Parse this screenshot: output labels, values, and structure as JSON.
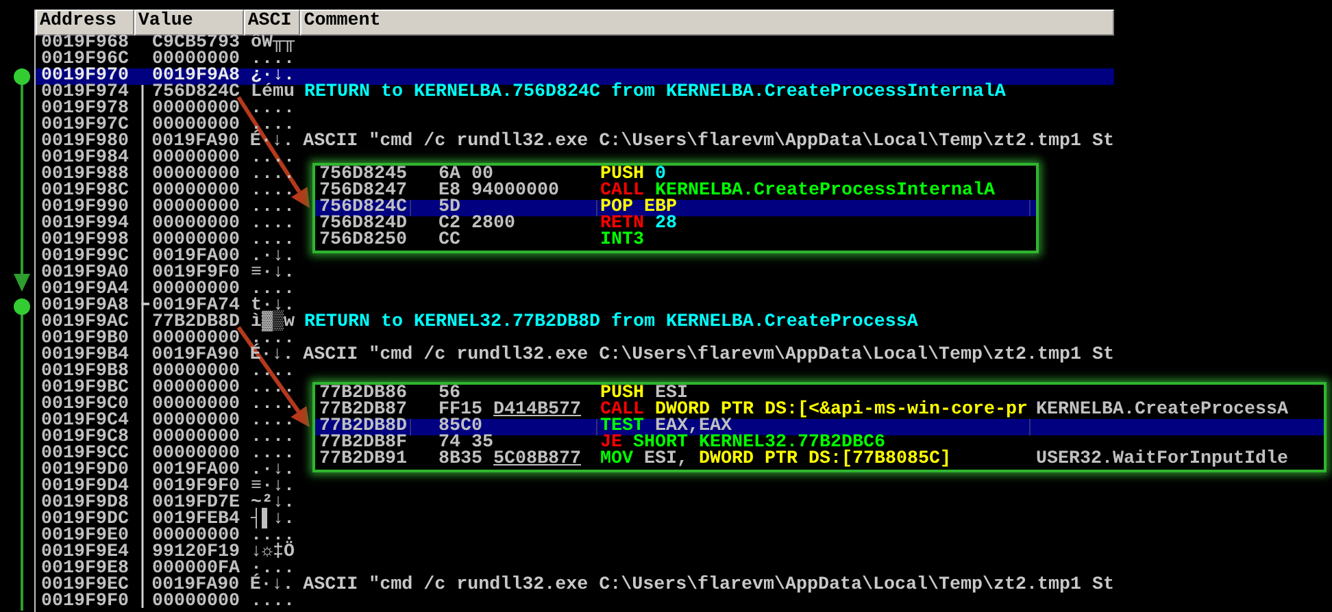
{
  "columns": [
    {
      "label": "Address"
    },
    {
      "label": "Value"
    },
    {
      "label": "ASCI"
    },
    {
      "label": "Comment"
    }
  ],
  "rows": [
    {
      "address": "0019F968",
      "value": "C9CB5793",
      "ascii": "ôW╥╥",
      "selected": false,
      "frame_start": false
    },
    {
      "address": "0019F96C",
      "value": "00000000",
      "ascii": "....",
      "selected": false,
      "frame_start": false
    },
    {
      "address": "0019F970",
      "value": "0019F9A8",
      "ascii": "¿·↓.",
      "selected": true,
      "frame_start": true
    },
    {
      "address": "0019F974",
      "value": "756D824C",
      "ascii": "Lému",
      "selected": false,
      "frame_start": false,
      "comment": {
        "kind": "return",
        "text": "RETURN to KERNELBA.756D824C from KERNELBA.CreateProcessInternalA"
      }
    },
    {
      "address": "0019F978",
      "value": "00000000",
      "ascii": "....",
      "selected": false,
      "frame_start": false
    },
    {
      "address": "0019F97C",
      "value": "00000000",
      "ascii": "....",
      "selected": false,
      "frame_start": false
    },
    {
      "address": "0019F980",
      "value": "0019FA90",
      "ascii": "É·↓.",
      "selected": false,
      "frame_start": false,
      "comment": {
        "kind": "ascii",
        "text": "ASCII \"cmd /c rundll32.exe C:\\Users\\flarevm\\AppData\\Local\\Temp\\zt2.tmp1 St"
      }
    },
    {
      "address": "0019F984",
      "value": "00000000",
      "ascii": "....",
      "selected": false,
      "frame_start": false
    },
    {
      "address": "0019F988",
      "value": "00000000",
      "ascii": "....",
      "selected": false,
      "frame_start": false
    },
    {
      "address": "0019F98C",
      "value": "00000000",
      "ascii": "....",
      "selected": false,
      "frame_start": false
    },
    {
      "address": "0019F990",
      "value": "00000000",
      "ascii": "....",
      "selected": false,
      "frame_start": false
    },
    {
      "address": "0019F994",
      "value": "00000000",
      "ascii": "....",
      "selected": false,
      "frame_start": false
    },
    {
      "address": "0019F998",
      "value": "00000000",
      "ascii": "....",
      "selected": false,
      "frame_start": false
    },
    {
      "address": "0019F99C",
      "value": "0019FA00",
      "ascii": ".·↓.",
      "selected": false,
      "frame_start": false
    },
    {
      "address": "0019F9A0",
      "value": "0019F9F0",
      "ascii": "≡·↓.",
      "selected": false,
      "frame_start": false
    },
    {
      "address": "0019F9A4",
      "value": "00000000",
      "ascii": "....",
      "selected": false,
      "frame_start": false
    },
    {
      "address": "0019F9A8",
      "value": "0019FA74",
      "ascii": "t·↓.",
      "selected": false,
      "frame_start": true
    },
    {
      "address": "0019F9AC",
      "value": "77B2DB8D",
      "ascii": "ì▓▒w",
      "selected": false,
      "frame_start": false,
      "comment": {
        "kind": "return",
        "text": "RETURN to KERNEL32.77B2DB8D from KERNELBA.CreateProcessA"
      }
    },
    {
      "address": "0019F9B0",
      "value": "00000000",
      "ascii": "....",
      "selected": false,
      "frame_start": false
    },
    {
      "address": "0019F9B4",
      "value": "0019FA90",
      "ascii": "É·↓.",
      "selected": false,
      "frame_start": false,
      "comment": {
        "kind": "ascii",
        "text": "ASCII \"cmd /c rundll32.exe C:\\Users\\flarevm\\AppData\\Local\\Temp\\zt2.tmp1 St"
      }
    },
    {
      "address": "0019F9B8",
      "value": "00000000",
      "ascii": "....",
      "selected": false,
      "frame_start": false
    },
    {
      "address": "0019F9BC",
      "value": "00000000",
      "ascii": "....",
      "selected": false,
      "frame_start": false
    },
    {
      "address": "0019F9C0",
      "value": "00000000",
      "ascii": "....",
      "selected": false,
      "frame_start": false
    },
    {
      "address": "0019F9C4",
      "value": "00000000",
      "ascii": "....",
      "selected": false,
      "frame_start": false
    },
    {
      "address": "0019F9C8",
      "value": "00000000",
      "ascii": "....",
      "selected": false,
      "frame_start": false
    },
    {
      "address": "0019F9CC",
      "value": "00000000",
      "ascii": "....",
      "selected": false,
      "frame_start": false
    },
    {
      "address": "0019F9D0",
      "value": "0019FA00",
      "ascii": ".·↓.",
      "selected": false,
      "frame_start": false
    },
    {
      "address": "0019F9D4",
      "value": "0019F9F0",
      "ascii": "≡·↓.",
      "selected": false,
      "frame_start": false
    },
    {
      "address": "0019F9D8",
      "value": "0019FD7E",
      "ascii": "~²↓.",
      "selected": false,
      "frame_start": false
    },
    {
      "address": "0019F9DC",
      "value": "0019FEB4",
      "ascii": "┤▌↓.",
      "selected": false,
      "frame_start": false
    },
    {
      "address": "0019F9E0",
      "value": "00000000",
      "ascii": "....",
      "selected": false,
      "frame_start": false
    },
    {
      "address": "0019F9E4",
      "value": "99120F19",
      "ascii": "↓☼‡Ö",
      "selected": false,
      "frame_start": false
    },
    {
      "address": "0019F9E8",
      "value": "000000FA",
      "ascii": "·...",
      "selected": false,
      "frame_start": false
    },
    {
      "address": "0019F9EC",
      "value": "0019FA90",
      "ascii": "É·↓.",
      "selected": false,
      "frame_start": false,
      "comment": {
        "kind": "ascii",
        "text": "ASCII \"cmd /c rundll32.exe C:\\Users\\flarevm\\AppData\\Local\\Temp\\zt2.tmp1 St"
      }
    },
    {
      "address": "0019F9F0",
      "value": "00000000",
      "ascii": "....",
      "selected": false,
      "frame_start": false
    }
  ],
  "popups": [
    {
      "rows": [
        {
          "address": "756D8245",
          "hex": "6A 00",
          "selected": false,
          "instruction": [
            {
              "text": "PUSH",
              "kind": "stack_op"
            },
            {
              "text": "0",
              "kind": "constant"
            }
          ]
        },
        {
          "address": "756D8247",
          "hex": "E8 94000000",
          "selected": false,
          "instruction": [
            {
              "text": "CALL",
              "kind": "branch_op"
            },
            {
              "text": "KERNELBA.CreateProcessInternalA",
              "kind": "label"
            }
          ]
        },
        {
          "address": "756D824C",
          "hex": "5D",
          "selected": true,
          "instruction": [
            {
              "text": "POP",
              "kind": "stack_op"
            },
            {
              "text": "EBP",
              "kind": "stack_operand"
            }
          ]
        },
        {
          "address": "756D824D",
          "hex": "C2 2800",
          "selected": false,
          "instruction": [
            {
              "text": "RETN",
              "kind": "branch_op"
            },
            {
              "text": "28",
              "kind": "constant"
            }
          ]
        },
        {
          "address": "756D8250",
          "hex": "CC",
          "selected": false,
          "instruction": [
            {
              "text": "INT3",
              "kind": "plain_op"
            }
          ]
        }
      ]
    },
    {
      "rows": [
        {
          "address": "77B2DB86",
          "hex": "56",
          "selected": false,
          "instruction": [
            {
              "text": "PUSH",
              "kind": "stack_op"
            },
            {
              "text": "ESI",
              "kind": "register"
            }
          ]
        },
        {
          "address": "77B2DB87",
          "hex": "FF15",
          "hex_ref": "D414B577",
          "selected": false,
          "instruction": [
            {
              "text": "CALL",
              "kind": "branch_op"
            },
            {
              "text": "DWORD PTR DS:[<&api-ms-win-core-pr",
              "kind": "memory"
            }
          ],
          "comment": "KERNELBA.CreateProcessA"
        },
        {
          "address": "77B2DB8D",
          "hex": "85C0",
          "selected": true,
          "instruction": [
            {
              "text": "TEST",
              "kind": "plain_op"
            },
            {
              "text": "EAX,EAX",
              "kind": "register"
            }
          ]
        },
        {
          "address": "77B2DB8F",
          "hex": "74 35",
          "selected": false,
          "instruction": [
            {
              "text": "JE",
              "kind": "branch_op"
            },
            {
              "text": "SHORT KERNEL32.77B2DBC6",
              "kind": "label"
            }
          ]
        },
        {
          "address": "77B2DB91",
          "hex": "8B35",
          "hex_ref": "5C08B877",
          "selected": false,
          "instruction": [
            {
              "text": "MOV",
              "kind": "plain_op"
            },
            {
              "text": "ESI,",
              "kind": "register"
            },
            {
              "text": "DWORD PTR DS:[77B8085C]",
              "kind": "memory"
            }
          ],
          "comment": "USER32.WaitForInputIdle"
        }
      ]
    }
  ]
}
